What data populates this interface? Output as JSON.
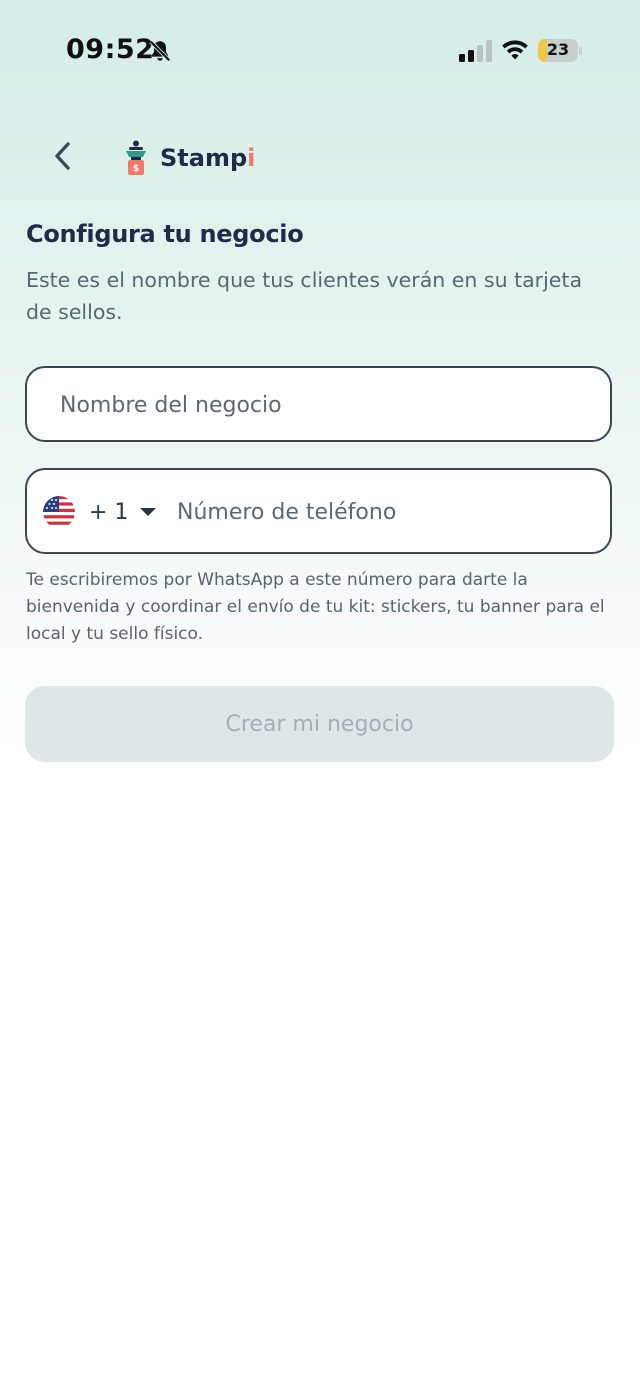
{
  "status_bar": {
    "time": "09:52",
    "battery_level": "23",
    "battery_percent": 23,
    "icons": [
      "bell-slash-icon",
      "cellular-signal-icon",
      "wifi-icon",
      "battery-charging-icon"
    ]
  },
  "header": {
    "back_icon": "chevron-left-icon",
    "logo_text_main": "Stamp",
    "logo_text_accent": "i"
  },
  "page": {
    "title": "Configura tu negocio",
    "subtitle": "Este es el nombre que tus clientes verán en su tarjeta de sellos."
  },
  "form": {
    "business_name": {
      "value": "",
      "placeholder": "Nombre del negocio"
    },
    "phone": {
      "country_flag": "us-flag-icon",
      "dial_code": "+ 1",
      "value": "",
      "placeholder": "Número de teléfono"
    },
    "helper_text": "Te escribiremos por WhatsApp a este número para darte la bienvenida y coordinar el envío de tu kit: stickers, tu banner para el local y tu sello físico.",
    "submit_label": "Crear mi negocio"
  },
  "colors": {
    "brand_navy": "#1e2b4a",
    "brand_coral": "#ee7a69",
    "brand_teal": "#2f9e8f",
    "disabled_button_bg": "#dfe6e8",
    "disabled_button_text": "#a4b0b5"
  }
}
